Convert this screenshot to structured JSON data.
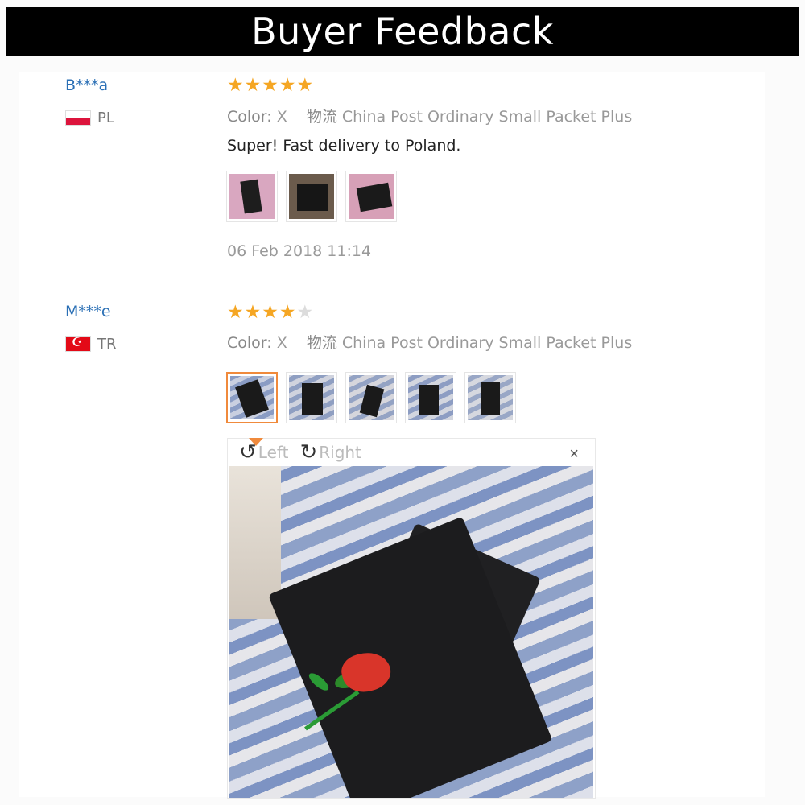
{
  "header": {
    "title": "Buyer Feedback"
  },
  "reviews": [
    {
      "user": "B***a",
      "country": "PL",
      "rating": 5,
      "color_label": "Color:",
      "color_value": "X",
      "shipping_label": "物流",
      "shipping_value": "China Post Ordinary Small Packet Plus",
      "text": "Super! Fast delivery to Poland.",
      "thumbnail_count": 3,
      "date": "06 Feb 2018 11:14"
    },
    {
      "user": "M***e",
      "country": "TR",
      "rating": 4.5,
      "color_label": "Color:",
      "color_value": "X",
      "shipping_label": "物流",
      "shipping_value": "China Post Ordinary Small Packet Plus",
      "thumbnail_count": 5,
      "selected_thumbnail": 1
    }
  ],
  "viewer": {
    "rotate_left_label": "Left",
    "rotate_right_label": "Right",
    "close_label": "×"
  },
  "colors": {
    "star": "#f5a623",
    "star_empty": "#dcdcdc",
    "username": "#2a6fb5",
    "active_thumb": "#f08a3c"
  }
}
